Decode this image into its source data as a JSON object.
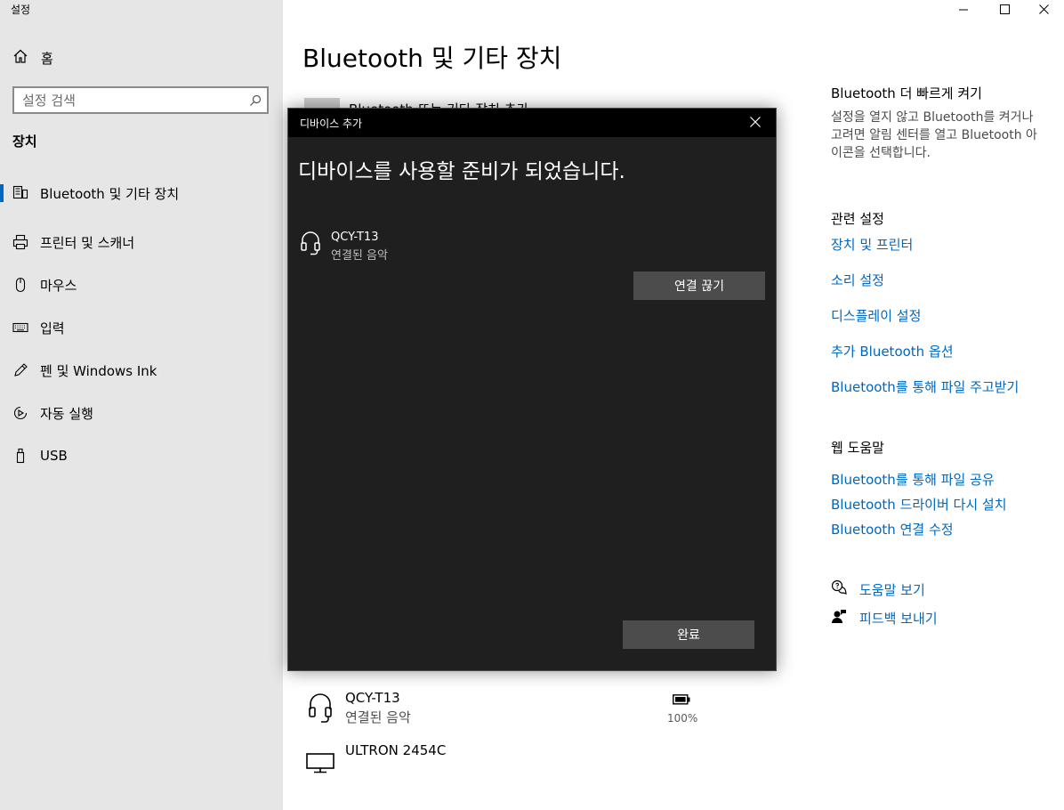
{
  "app": {
    "title": "설정"
  },
  "window_controls": {
    "minimize_icon": "minimize-icon",
    "maximize_icon": "maximize-icon",
    "close_icon": "close-icon"
  },
  "sidebar": {
    "home_label": "홈",
    "search_placeholder": "설정 검색",
    "section_title": "장치",
    "items": [
      {
        "label": "Bluetooth 및 기타 장치",
        "icon": "bluetooth-devices-icon",
        "active": true
      },
      {
        "label": "프린터 및 스캐너",
        "icon": "printer-icon",
        "active": false
      },
      {
        "label": "마우스",
        "icon": "mouse-icon",
        "active": false
      },
      {
        "label": "입력",
        "icon": "keyboard-icon",
        "active": false
      },
      {
        "label": "펜 및 Windows Ink",
        "icon": "pen-icon",
        "active": false
      },
      {
        "label": "자동 실행",
        "icon": "autoplay-icon",
        "active": false
      },
      {
        "label": "USB",
        "icon": "usb-icon",
        "active": false
      }
    ]
  },
  "main": {
    "title": "Bluetooth 및 기타 장치",
    "add_device_label": "Bluetooth 또는 기타 장치 추가",
    "devices": [
      {
        "name": "QCY-T13",
        "status": "연결된 음악",
        "icon": "headset-icon",
        "battery": "100%"
      },
      {
        "name": "ULTRON 2454C",
        "status": "",
        "icon": "monitor-icon"
      }
    ]
  },
  "right": {
    "faster_heading": "Bluetooth 더 빠르게 켜기",
    "faster_text": "설정을 열지 않고 Bluetooth를 켜거나 고려면 알림 센터를 열고 Bluetooth 아이콘을 선택합니다.",
    "related_heading": "관련 설정",
    "related_links": [
      "장치 및 프린터",
      "소리 설정",
      "디스플레이 설정",
      "추가 Bluetooth 옵션",
      "Bluetooth를 통해 파일 주고받기"
    ],
    "web_help_heading": "웹 도움말",
    "web_help_links": [
      "Bluetooth를 통해 파일 공유",
      "Bluetooth 드라이버 다시 설치",
      "Bluetooth 연결 수정"
    ],
    "get_help": "도움말 보기",
    "feedback": "피드백 보내기"
  },
  "dialog": {
    "title": "디바이스 추가",
    "heading": "디바이스를 사용할 준비가 되었습니다.",
    "device": {
      "name": "QCY-T13",
      "status": "연결된 음악",
      "icon": "headset-icon"
    },
    "disconnect_label": "연결 끊기",
    "done_label": "완료"
  },
  "colors": {
    "link": "#0067c0",
    "sidebar_bg": "#e6e6e6",
    "dialog_bg": "#1f1f1f",
    "dialog_button": "#4c4c4c",
    "accent": "#0067c0"
  }
}
